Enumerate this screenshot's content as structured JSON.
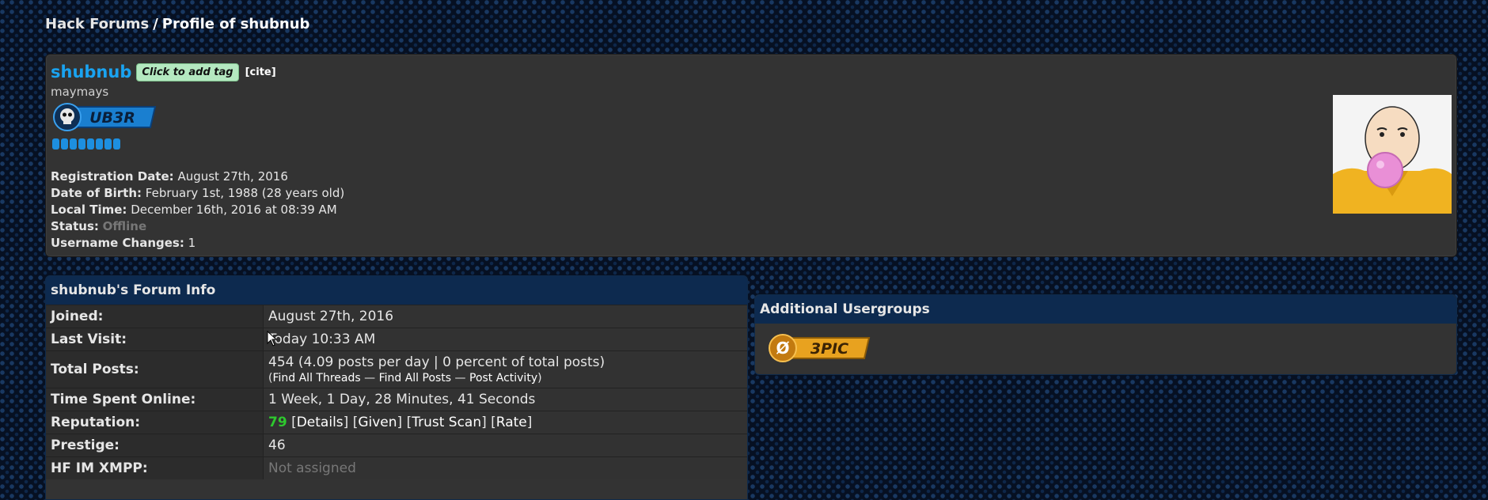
{
  "breadcrumb": {
    "home": "Hack Forums",
    "separator": "/",
    "current": "Profile of shubnub"
  },
  "profile": {
    "username": "shubnub",
    "tag_button": "Click to add tag",
    "cite": "[cite]",
    "user_title": "maymays",
    "group_badge": "UB3R",
    "star_count": 8,
    "details": [
      {
        "label": "Registration Date:",
        "value": "August 27th, 2016"
      },
      {
        "label": "Date of Birth:",
        "value": "February 1st, 1988 (28 years old)"
      },
      {
        "label": "Local Time:",
        "value": "December 16th, 2016 at 08:39 AM"
      },
      {
        "label": "Status:",
        "value": "Offline"
      },
      {
        "label": "Username Changes:",
        "value": "1"
      }
    ]
  },
  "forum_info": {
    "title": "shubnub's Forum Info",
    "rows": {
      "joined": {
        "label": "Joined:",
        "value": "August 27th, 2016"
      },
      "last_visit": {
        "label": "Last Visit:",
        "value": "Today 10:33 AM"
      },
      "total_posts": {
        "label": "Total Posts:",
        "value": "454 (4.09 posts per day | 0 percent of total posts)",
        "open": "(",
        "find_threads": "Find All Threads",
        "dash1": " — ",
        "find_posts": "Find All Posts",
        "dash2": " — ",
        "post_activity": "Post Activity",
        "close": ")"
      },
      "time_online": {
        "label": "Time Spent Online:",
        "value": "1 Week, 1 Day, 28 Minutes, 41 Seconds"
      },
      "reputation": {
        "label": "Reputation:",
        "value": "79",
        "details": "Details",
        "given": "Given",
        "trust_scan": "Trust Scan",
        "rate": "Rate"
      },
      "prestige": {
        "label": "Prestige:",
        "value": "46"
      },
      "xmpp": {
        "label": "HF IM XMPP:",
        "value": "Not assigned"
      }
    }
  },
  "usergroups": {
    "title": "Additional Usergroups",
    "badge": "3PIC"
  },
  "colors": {
    "link_blue": "#1aa3f0",
    "rep_green": "#2ec82e",
    "header_navy": "#0d2a4f"
  }
}
